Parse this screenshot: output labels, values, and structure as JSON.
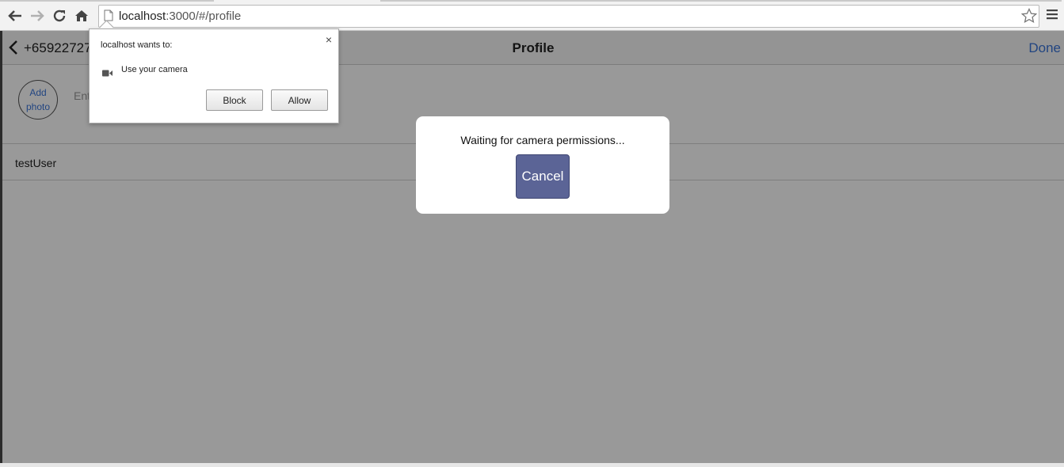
{
  "browser": {
    "url_host": "localhost",
    "url_rest": ":3000/#/profile"
  },
  "navbar": {
    "back_label": "+65922727",
    "title": "Profile",
    "done_label": "Done"
  },
  "profile": {
    "photo_label_line1": "Add",
    "photo_label_line2": "photo",
    "name_placeholder": "Ent",
    "username": "testUser"
  },
  "modal": {
    "message": "Waiting for camera permissions...",
    "cancel_label": "Cancel"
  },
  "permission_bubble": {
    "title": "localhost wants to:",
    "permission": "Use your camera",
    "block_label": "Block",
    "allow_label": "Allow",
    "close_glyph": "×"
  },
  "icons": {
    "back": "arrow-left-icon",
    "forward": "arrow-right-icon",
    "reload": "reload-icon",
    "home": "home-icon",
    "page": "page-icon",
    "star": "star-icon",
    "menu": "hamburger-menu-icon",
    "camera": "camera-icon",
    "chevron": "chevron-left-icon"
  },
  "colors": {
    "link_blue": "#3a74d8",
    "cancel_button": "#5b6496"
  }
}
